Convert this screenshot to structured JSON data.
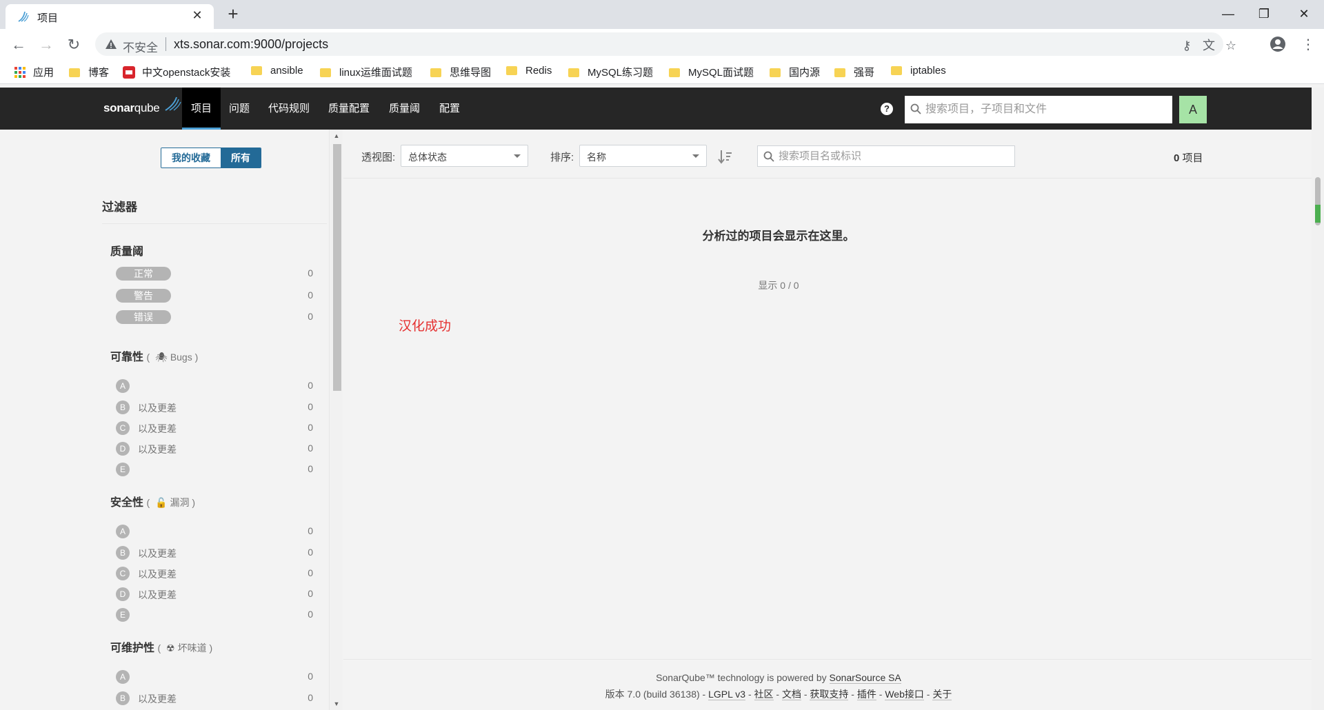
{
  "browser": {
    "tab_title": "项目",
    "url_insecure_label": "不安全",
    "url": "xts.sonar.com:9000/projects",
    "bookmarks": [
      {
        "label": "应用",
        "kind": "apps"
      },
      {
        "label": "博客",
        "kind": "folder"
      },
      {
        "label": "中文openstack安装",
        "kind": "site"
      },
      {
        "label": "ansible",
        "kind": "folder"
      },
      {
        "label": "linux运维面试题",
        "kind": "folder"
      },
      {
        "label": "思维导图",
        "kind": "folder"
      },
      {
        "label": "Redis",
        "kind": "folder"
      },
      {
        "label": "MySQL练习题",
        "kind": "folder"
      },
      {
        "label": "MySQL面试题",
        "kind": "folder"
      },
      {
        "label": "国内源",
        "kind": "folder"
      },
      {
        "label": "强哥",
        "kind": "folder"
      },
      {
        "label": "iptables",
        "kind": "folder"
      }
    ]
  },
  "navbar": {
    "logo_bold": "sonar",
    "logo_light": "qube",
    "menu": [
      "项目",
      "问题",
      "代码规则",
      "质量配置",
      "质量阈",
      "配置"
    ],
    "search_placeholder": "搜索项目，子项目和文件",
    "avatar_letter": "A"
  },
  "sidebar": {
    "toggle": {
      "mine": "我的收藏",
      "all": "所有"
    },
    "filters_title": "过滤器",
    "quality_gate": {
      "title": "质量阈",
      "items": [
        {
          "label": "正常",
          "count": "0"
        },
        {
          "label": "警告",
          "count": "0"
        },
        {
          "label": "错误",
          "count": "0"
        }
      ]
    },
    "reliability": {
      "title": "可靠性",
      "sub": "Bugs",
      "items": [
        {
          "rating": "A",
          "label": "",
          "count": "0"
        },
        {
          "rating": "B",
          "label": "以及更差",
          "count": "0"
        },
        {
          "rating": "C",
          "label": "以及更差",
          "count": "0"
        },
        {
          "rating": "D",
          "label": "以及更差",
          "count": "0"
        },
        {
          "rating": "E",
          "label": "",
          "count": "0"
        }
      ]
    },
    "security": {
      "title": "安全性",
      "sub": "漏洞",
      "items": [
        {
          "rating": "A",
          "label": "",
          "count": "0"
        },
        {
          "rating": "B",
          "label": "以及更差",
          "count": "0"
        },
        {
          "rating": "C",
          "label": "以及更差",
          "count": "0"
        },
        {
          "rating": "D",
          "label": "以及更差",
          "count": "0"
        },
        {
          "rating": "E",
          "label": "",
          "count": "0"
        }
      ]
    },
    "maintainability": {
      "title": "可维护性",
      "sub": "坏味道",
      "items": [
        {
          "rating": "A",
          "label": "",
          "count": "0"
        },
        {
          "rating": "B",
          "label": "以及更差",
          "count": "0"
        }
      ]
    }
  },
  "main": {
    "perspective_label": "透视图:",
    "perspective_value": "总体状态",
    "sort_label": "排序:",
    "sort_value": "名称",
    "search_placeholder": "搜索项目名或标识",
    "count_number": "0",
    "count_unit": "项目",
    "empty_message": "分析过的项目会显示在这里。",
    "showing": "显示 0 / 0",
    "note": "汉化成功"
  },
  "footer": {
    "line1_prefix": "SonarQube™ technology is powered by ",
    "line1_link": "SonarSource SA",
    "version": "版本 7.0 (build 36138)",
    "links": [
      "LGPL v3",
      "社区",
      "文档",
      "获取支持",
      "插件",
      "Web接口",
      "关于"
    ],
    "separator": " - "
  }
}
